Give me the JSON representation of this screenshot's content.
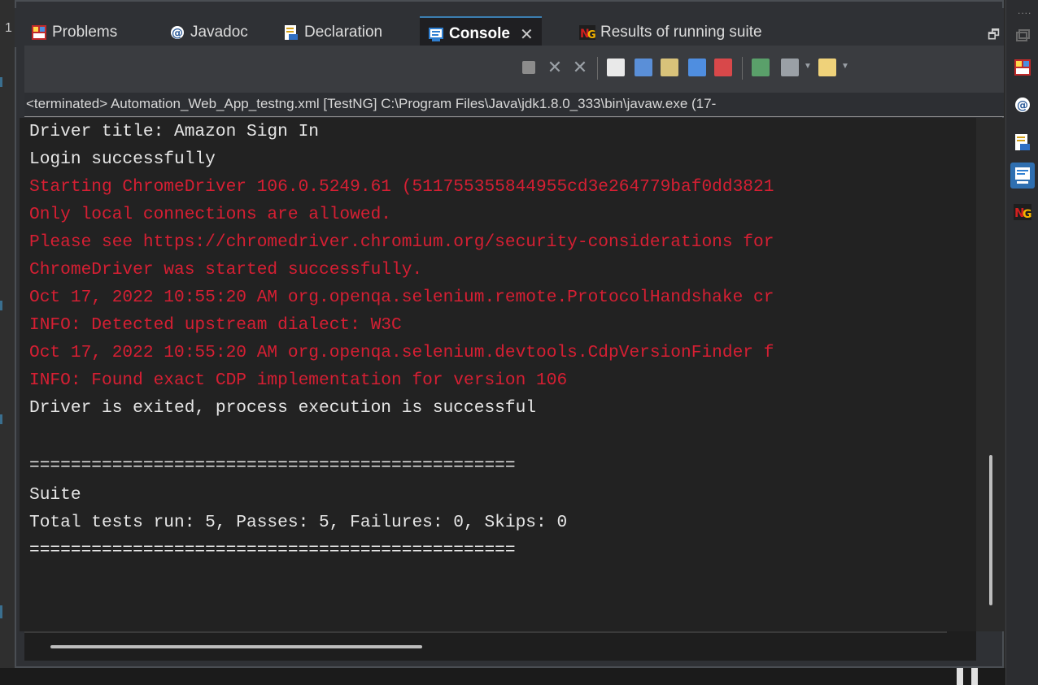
{
  "left_editor": {
    "line_digit": "1"
  },
  "tabs": [
    {
      "label": "Problems",
      "icon": "problems-icon"
    },
    {
      "label": "Javadoc",
      "icon": "javadoc-icon"
    },
    {
      "label": "Declaration",
      "icon": "declaration-icon"
    },
    {
      "label": "Console",
      "icon": "console-icon",
      "active": true
    },
    {
      "label": "Results of running suite",
      "icon": "testng-icon"
    }
  ],
  "status_line": "<terminated> Automation_Web_App_testng.xml [TestNG] C:\\Program Files\\Java\\jdk1.8.0_333\\bin\\javaw.exe  (17-",
  "console_lines": [
    {
      "text": "Driver title: Amazon Sign In",
      "stream": "stdout"
    },
    {
      "text": "Login successfully",
      "stream": "stdout"
    },
    {
      "text": "Starting ChromeDriver 106.0.5249.61 (511755355844955cd3e264779baf0dd3821",
      "stream": "stderr"
    },
    {
      "text": "Only local connections are allowed.",
      "stream": "stderr"
    },
    {
      "text": "Please see https://chromedriver.chromium.org/security-considerations for",
      "stream": "stderr"
    },
    {
      "text": "ChromeDriver was started successfully.",
      "stream": "stderr"
    },
    {
      "text": "Oct 17, 2022 10:55:20 AM org.openqa.selenium.remote.ProtocolHandshake cr",
      "stream": "stderr"
    },
    {
      "text": "INFO: Detected upstream dialect: W3C",
      "stream": "stderr"
    },
    {
      "text": "Oct 17, 2022 10:55:20 AM org.openqa.selenium.devtools.CdpVersionFinder f",
      "stream": "stderr"
    },
    {
      "text": "INFO: Found exact CDP implementation for version 106",
      "stream": "stderr"
    },
    {
      "text": "Driver is exited, process execution is successful",
      "stream": "stdout"
    },
    {
      "text": "",
      "stream": "stdout"
    },
    {
      "text": "===============================================",
      "stream": "stdout"
    },
    {
      "text": "Suite",
      "stream": "stdout"
    },
    {
      "text": "Total tests run: 5, Passes: 5, Failures: 0, Skips: 0",
      "stream": "stdout"
    },
    {
      "text": "===============================================",
      "stream": "stdout"
    }
  ],
  "colors": {
    "stdout": "#e6e6e6",
    "stderr": "#d61f33",
    "active_tab_accent": "#3c7fb1"
  },
  "toolbar_icons": [
    "terminate-icon",
    "remove-launch-icon",
    "remove-all-terminated-icon",
    "clear-console-icon",
    "scroll-lock-icon",
    "word-wrap-icon",
    "show-on-stdout-icon",
    "show-on-stderr-icon",
    "pin-console-icon",
    "display-selected-console-icon",
    "open-console-icon"
  ],
  "right_trim_icons": [
    "problems-icon",
    "javadoc-icon",
    "declaration-icon",
    "console-icon",
    "testng-icon"
  ]
}
